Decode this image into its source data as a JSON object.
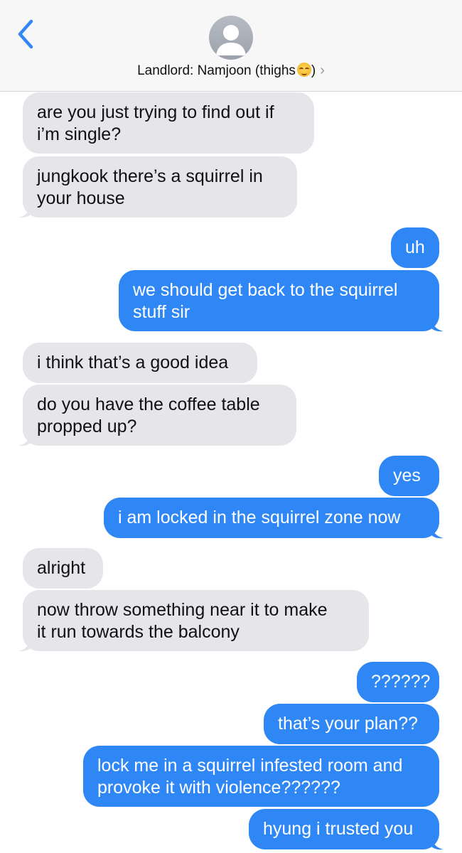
{
  "header": {
    "back_label": "<",
    "contact_name": "Landlord: Namjoon (thighs",
    "contact_suffix": ")",
    "chevron": "›"
  },
  "messages": [
    {
      "from": "contact",
      "lines": [
        "are you just trying to find out if",
        "i’m single?"
      ]
    },
    {
      "from": "contact",
      "lines": [
        "jungkook there’s a squirrel in",
        "your house"
      ]
    },
    {
      "from": "me",
      "lines": [
        "uh"
      ]
    },
    {
      "from": "me",
      "lines": [
        "we should get back to the squirrel",
        "stuff sir"
      ]
    },
    {
      "from": "contact",
      "lines": [
        "i think that’s a good idea"
      ]
    },
    {
      "from": "contact",
      "lines": [
        "do you have the coffee table",
        "propped up?"
      ]
    },
    {
      "from": "me",
      "lines": [
        "yes"
      ]
    },
    {
      "from": "me",
      "lines": [
        "i am locked in the squirrel zone now"
      ]
    },
    {
      "from": "contact",
      "lines": [
        "alright"
      ]
    },
    {
      "from": "contact",
      "lines": [
        "now throw something near it to make",
        "it run towards the balcony"
      ]
    },
    {
      "from": "me",
      "lines": [
        "??????"
      ]
    },
    {
      "from": "me",
      "lines": [
        "that’s your plan??"
      ]
    },
    {
      "from": "me",
      "lines": [
        "lock me in a squirrel infested room and",
        "provoke it with violence??????"
      ]
    },
    {
      "from": "me",
      "lines": [
        "hyung i trusted you"
      ]
    }
  ],
  "colors": {
    "incoming": "#e5e5ea",
    "outgoing": "#2f87f6",
    "accent": "#2f87f6"
  },
  "icons": {
    "back": "chevron-left-icon",
    "avatar": "person-silhouette-icon",
    "emoji": "relieved-face-emoji-icon"
  }
}
